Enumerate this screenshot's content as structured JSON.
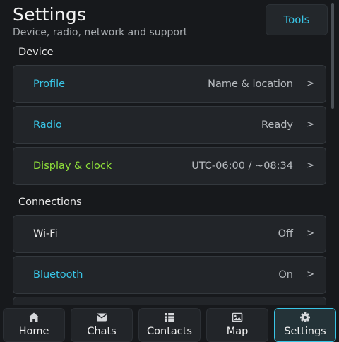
{
  "header": {
    "title": "Settings",
    "subtitle": "Device, radio, network and support",
    "tools_label": "Tools"
  },
  "sections": [
    {
      "title": "Device",
      "rows": [
        {
          "label": "Profile",
          "value": "Name & location",
          "chevron": ">",
          "label_color": "#39c5e6"
        },
        {
          "label": "Radio",
          "value": "Ready",
          "chevron": ">",
          "label_color": "#39c5e6"
        },
        {
          "label": "Display & clock",
          "value": "UTC-06:00 / ~08:34",
          "chevron": ">",
          "label_color": "#8fe03a"
        }
      ]
    },
    {
      "title": "Connections",
      "rows": [
        {
          "label": "Wi-Fi",
          "value": "Off",
          "chevron": ">",
          "label_color": "#e8e8e8"
        },
        {
          "label": "Bluetooth",
          "value": "On",
          "chevron": ">",
          "label_color": "#39c5e6"
        }
      ]
    }
  ],
  "nav": {
    "items": [
      {
        "label": "Home",
        "icon": "home-icon"
      },
      {
        "label": "Chats",
        "icon": "chat-icon"
      },
      {
        "label": "Contacts",
        "icon": "contacts-list-icon"
      },
      {
        "label": "Map",
        "icon": "map-image-icon"
      },
      {
        "label": "Settings",
        "icon": "gear-icon",
        "active": true
      }
    ]
  },
  "colors": {
    "background": "#17191c",
    "card": "#222529",
    "accent": "#39c5e6",
    "green": "#8fe03a",
    "muted": "#b8bcc0"
  }
}
